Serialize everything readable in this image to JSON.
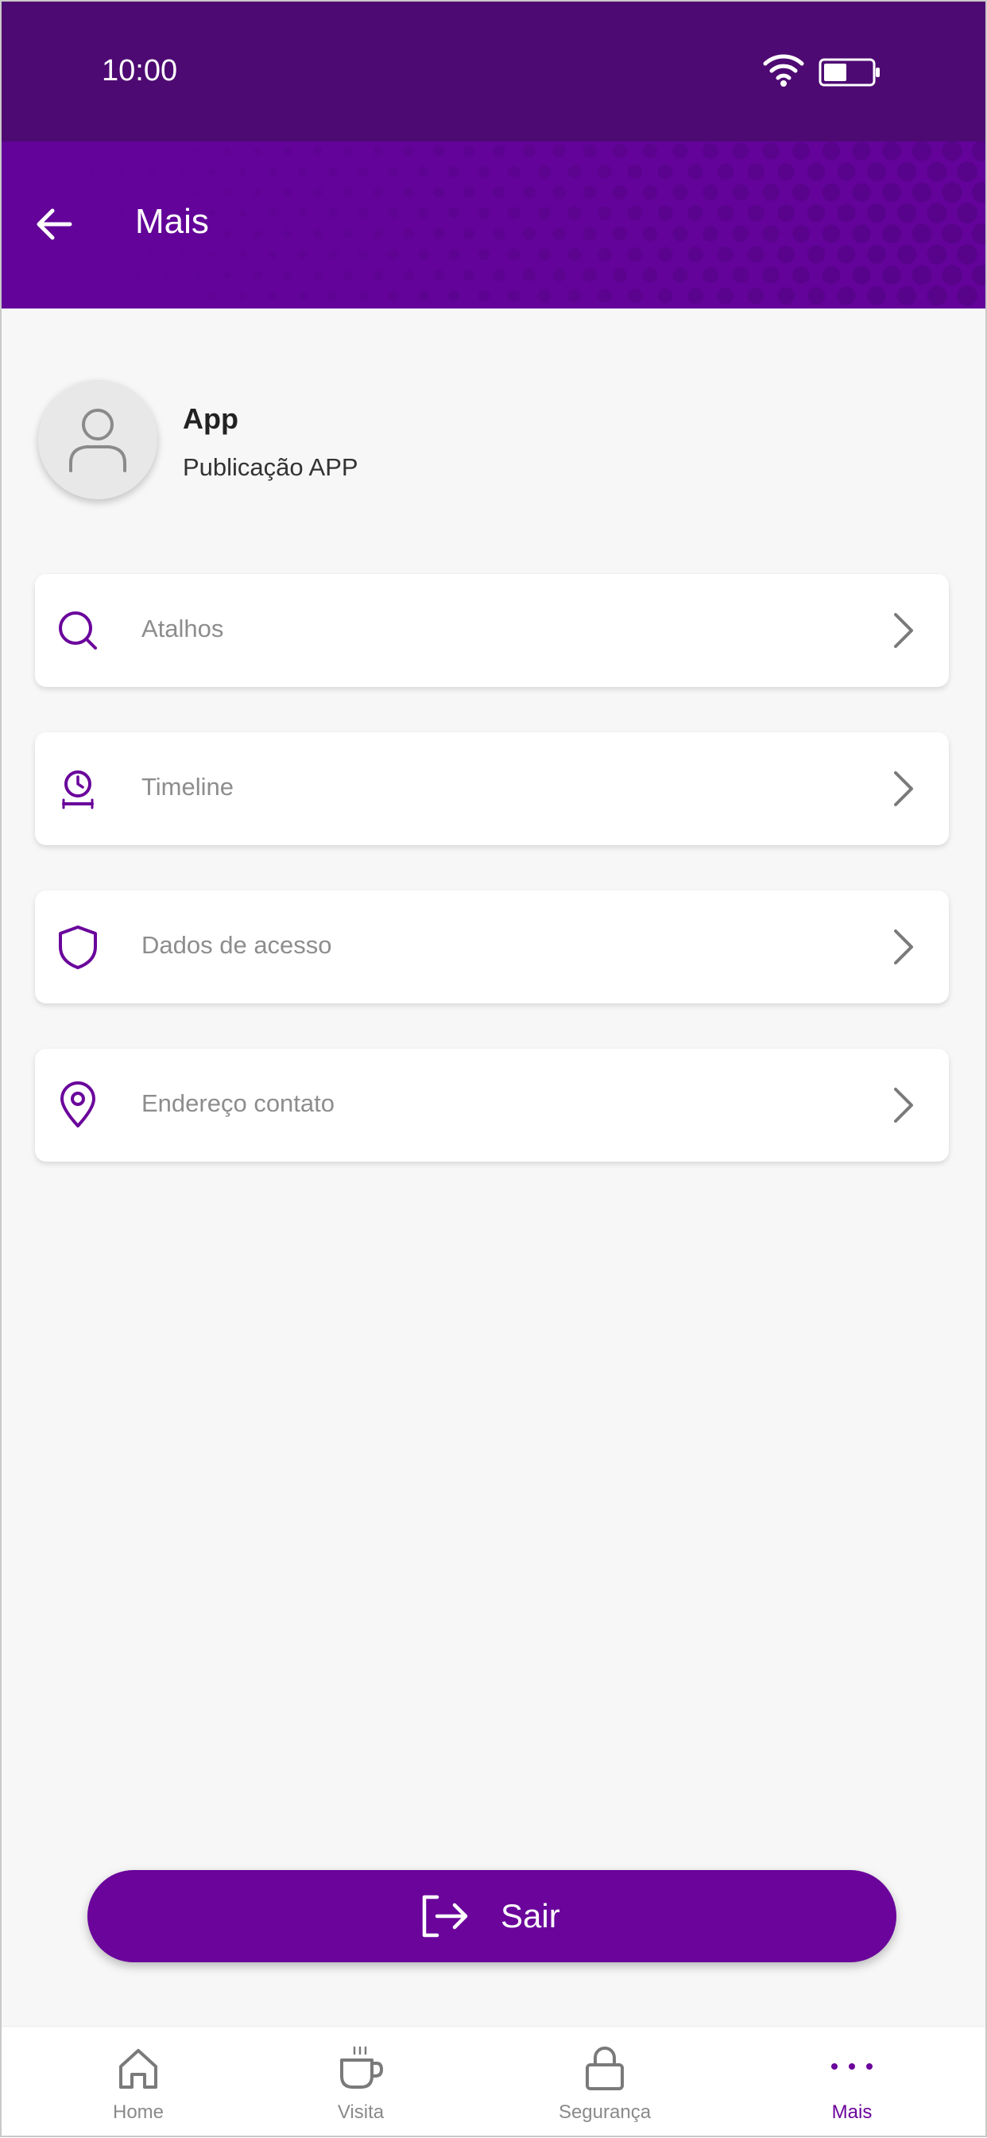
{
  "status_bar": {
    "time": "10:00"
  },
  "header": {
    "title": "Mais"
  },
  "profile": {
    "name": "App",
    "subtitle": "Publicação APP"
  },
  "menu": [
    {
      "label": "Atalhos",
      "icon": "search-icon"
    },
    {
      "label": "Timeline",
      "icon": "timeline-clock-icon"
    },
    {
      "label": "Dados de acesso",
      "icon": "shield-icon"
    },
    {
      "label": "Endereço contato",
      "icon": "location-pin-icon"
    }
  ],
  "logout": {
    "label": "Sair",
    "icon": "logout-icon"
  },
  "bottom_nav": [
    {
      "label": "Home",
      "icon": "home-icon",
      "active": false
    },
    {
      "label": "Visita",
      "icon": "coffee-cup-icon",
      "active": false
    },
    {
      "label": "Segurança",
      "icon": "lock-icon",
      "active": false
    },
    {
      "label": "Mais",
      "icon": "more-dots-icon",
      "active": true
    }
  ],
  "colors": {
    "status_bar": "#4e0a73",
    "app_bar": "#630399",
    "accent": "#6a049b",
    "background": "#f7f7f7",
    "menu_text": "#8d8d8d"
  }
}
